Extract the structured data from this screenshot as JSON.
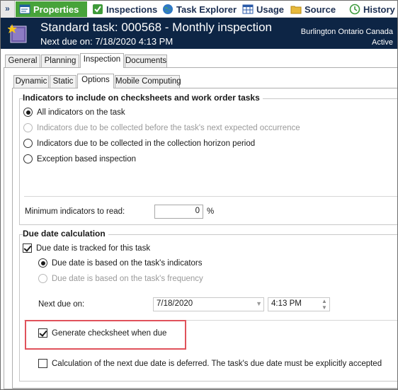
{
  "toolbar": {
    "items": [
      {
        "label": "Properties",
        "icon": "properties-icon"
      },
      {
        "label": "Inspections",
        "icon": "inspections-icon"
      },
      {
        "label": "Task Explorer",
        "icon": "globe-icon"
      },
      {
        "label": "Usage",
        "icon": "grid-icon"
      },
      {
        "label": "Source",
        "icon": "folder-icon"
      },
      {
        "label": "History",
        "icon": "history-icon"
      }
    ],
    "active": "Properties",
    "chevron": "»"
  },
  "header": {
    "title": "Standard task: 000568 - Monthly inspection",
    "subtitle": "Next due on: 7/18/2020 4:13 PM",
    "location": "Burlington Ontario Canada",
    "status": "Active"
  },
  "main_tabs": [
    "General",
    "Planning",
    "Inspection",
    "Documents"
  ],
  "main_tab_selected": "Inspection",
  "sub_tabs": [
    "Dynamic",
    "Static",
    "Options",
    "Mobile Computing"
  ],
  "sub_tab_selected": "Options",
  "indicators": {
    "title": "Indicators to include on checksheets and work order tasks",
    "options": [
      {
        "label": "All indicators on the task",
        "selected": true,
        "enabled": true
      },
      {
        "label": "Indicators due to be collected before the task's next expected occurrence",
        "selected": false,
        "enabled": false
      },
      {
        "label": "Indicators due to  be collected in the collection horizon period",
        "selected": false,
        "enabled": true
      },
      {
        "label": "Exception based inspection",
        "selected": false,
        "enabled": true
      }
    ],
    "min_label": "Minimum indicators to read:",
    "min_value": "0",
    "min_unit": "%"
  },
  "due_date": {
    "title": "Due date calculation",
    "tracked_label": "Due date is tracked for this task",
    "tracked": true,
    "based_options": [
      {
        "label": "Due date is based on the task's indicators",
        "selected": true,
        "enabled": true
      },
      {
        "label": "Due date is based on the task's frequency",
        "selected": false,
        "enabled": false
      }
    ],
    "next_due_label": "Next due on:",
    "next_due_date": "7/18/2020",
    "next_due_time": "4:13 PM",
    "generate_label": "Generate checksheet when due",
    "generate": true,
    "deferred_label": "Calculation of the next due date is deferred. The task's due date must be explicitly accepted",
    "deferred": false
  },
  "colors": {
    "header_bg": "#0d2545",
    "active_tab_bg": "#47a33a",
    "highlight": "#e0525b"
  }
}
